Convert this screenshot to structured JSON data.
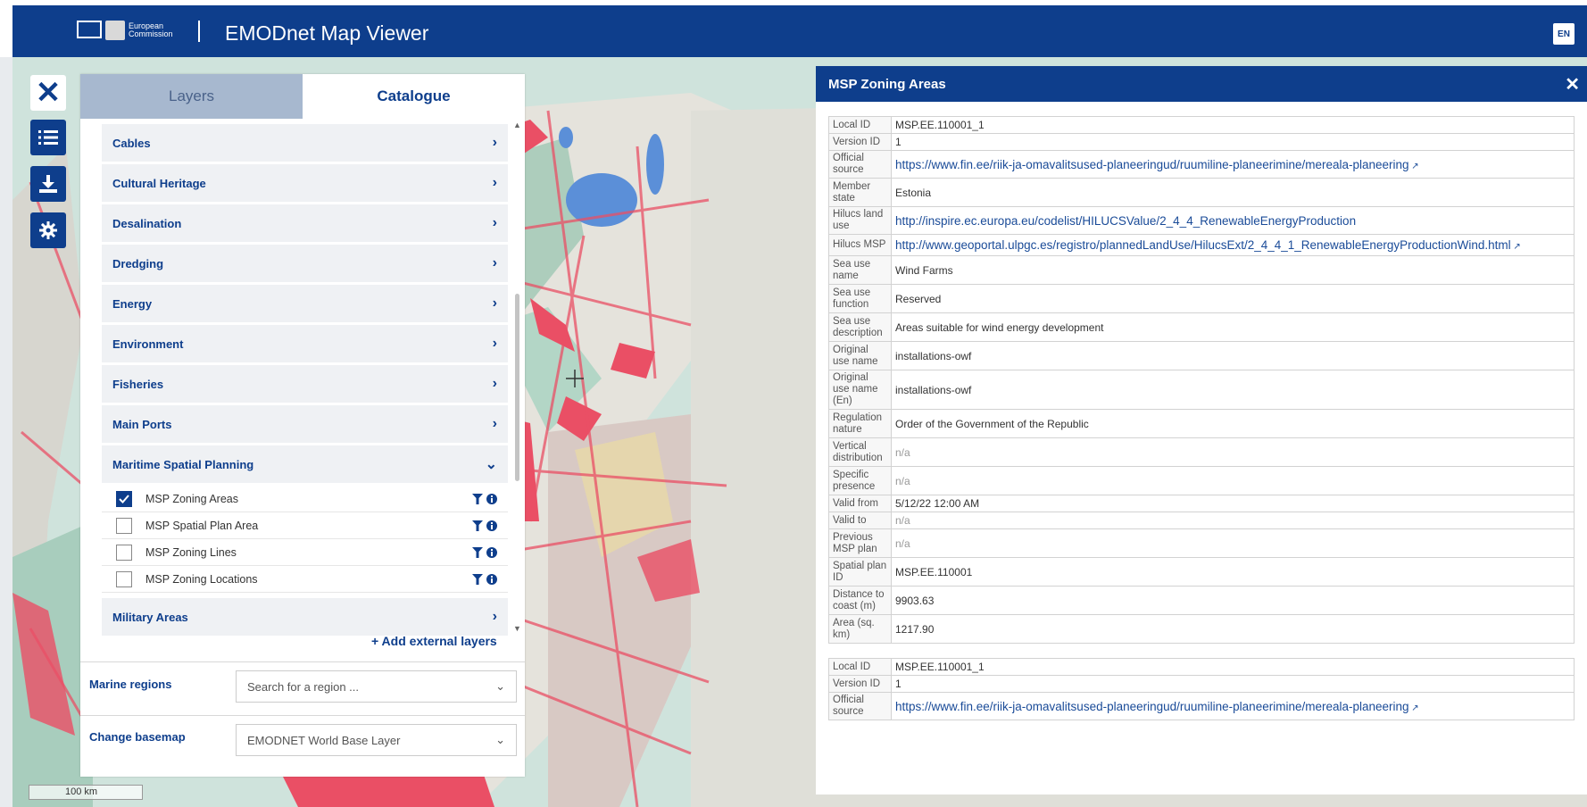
{
  "header": {
    "ec_line1": "European",
    "ec_line2": "Commission",
    "title": "EMODnet Map Viewer",
    "lang": "EN"
  },
  "toolbar": {
    "close_icon": "close-icon",
    "items": [
      "list-icon",
      "download-icon",
      "gear-icon"
    ]
  },
  "panel": {
    "tabs": [
      {
        "label": "Layers",
        "active": false
      },
      {
        "label": "Catalogue",
        "active": true
      }
    ],
    "categories_top": [
      "Cables",
      "Cultural Heritage",
      "Desalination",
      "Dredging",
      "Energy",
      "Environment",
      "Fisheries",
      "Main Ports"
    ],
    "expanded_category": "Maritime Spatial Planning",
    "sub_layers": [
      {
        "label": "MSP Zoning Areas",
        "checked": true
      },
      {
        "label": "MSP Spatial Plan Area",
        "checked": false
      },
      {
        "label": "MSP Zoning Lines",
        "checked": false
      },
      {
        "label": "MSP Zoning Locations",
        "checked": false
      }
    ],
    "categories_bottom": [
      "Military Areas"
    ],
    "add_external": "+ Add external layers",
    "marine_regions": {
      "label": "Marine regions",
      "placeholder": "Search for a region ..."
    },
    "basemap": {
      "label": "Change basemap",
      "value": "EMODNET World Base Layer"
    }
  },
  "info": {
    "title": "MSP Zoning Areas",
    "records": [
      [
        [
          "Local ID",
          "MSP.EE.110001_1"
        ],
        [
          "Version ID",
          "1"
        ],
        [
          "Official source",
          "https://www.fin.ee/riik-ja-omavalitsused-planeeringud/ruumiline-planeerimine/mereala-planeering"
        ],
        [
          "Member state",
          "Estonia"
        ],
        [
          "Hilucs land use",
          "http://inspire.ec.europa.eu/codelist/HILUCSValue/2_4_4_RenewableEnergyProduction"
        ],
        [
          "Hilucs MSP",
          "http://www.geoportal.ulpgc.es/registro/plannedLandUse/HilucsExt/2_4_4_1_RenewableEnergyProductionWind.html"
        ],
        [
          "Sea use name",
          "Wind Farms"
        ],
        [
          "Sea use function",
          "Reserved"
        ],
        [
          "Sea use description",
          "Areas suitable for wind energy development"
        ],
        [
          "Original use name",
          "installations-owf"
        ],
        [
          "Original use name (En)",
          "installations-owf"
        ],
        [
          "Regulation nature",
          "Order of the Government of the Republic"
        ],
        [
          "Vertical distribution",
          "n/a"
        ],
        [
          "Specific presence",
          "n/a"
        ],
        [
          "Valid from",
          "5/12/22 12:00 AM"
        ],
        [
          "Valid to",
          "n/a"
        ],
        [
          "Previous MSP plan",
          "n/a"
        ],
        [
          "Spatial plan ID",
          "MSP.EE.110001"
        ],
        [
          "Distance to coast (m)",
          "9903.63"
        ],
        [
          "Area (sq. km)",
          "1217.90"
        ]
      ],
      [
        [
          "Local ID",
          "MSP.EE.110001_1"
        ],
        [
          "Version ID",
          "1"
        ],
        [
          "Official source",
          "https://www.fin.ee/riik-ja-omavalitsused-planeeringud/ruumiline-planeerimine/mereala-planeering"
        ]
      ]
    ]
  },
  "scale": "100 km"
}
